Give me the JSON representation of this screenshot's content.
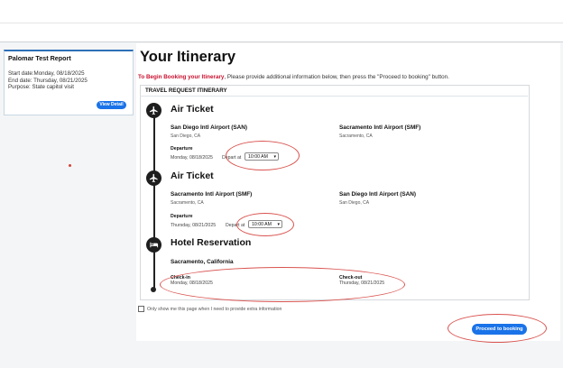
{
  "trip": {
    "name": "Palomar Test Report",
    "start_date": "Start date:Monday, 08/18/2025",
    "end_date": "End date:  Thursday, 08/21/2025",
    "purpose": "Purpose:  State capitol visit",
    "view_details_label": "View Detail"
  },
  "page": {
    "title": "Your Itinerary",
    "instruction_lead": "To Begin Booking your Itinerary",
    "instruction_rest": ", Please provide additional information below, then press the \"Proceed to booking\" button.",
    "section_title": "TRAVEL REQUEST ITINERARY"
  },
  "segments": [
    {
      "title": "Air Ticket",
      "from_airport": "San Diego Intl Airport (SAN)",
      "from_city": "San Diego, CA",
      "to_airport": "Sacramento Intl Airport (SMF)",
      "to_city": "Sacramento, CA",
      "departure_label": "Departure",
      "departure_date": "Monday, 08/18/2025",
      "depart_at_label": "Depart at",
      "depart_time": "10:00 AM"
    },
    {
      "title": "Air Ticket",
      "from_airport": "Sacramento Intl Airport (SMF)",
      "from_city": "Sacramento, CA",
      "to_airport": "San Diego Intl Airport (SAN)",
      "to_city": "San Diego, CA",
      "departure_label": "Departure",
      "departure_date": "Thursday, 08/21/2025",
      "depart_at_label": "Depart at",
      "depart_time": "10:00 AM"
    }
  ],
  "hotel": {
    "title": "Hotel Reservation",
    "location": "Sacramento, California",
    "checkin_label": "Check-in",
    "checkin_date": "Monday, 08/18/2025",
    "checkout_label": "Check-out",
    "checkout_date": "Thursday, 08/21/2025"
  },
  "footer": {
    "checkbox_label": "Only show me this page when I need to provide extra information",
    "proceed_label": "Proceed to booking"
  },
  "icons": {
    "flight": "airplane-icon",
    "hotel": "bed-icon"
  },
  "colors": {
    "accent_blue": "#1a73e8",
    "instruction_red": "#c8102e",
    "annotation_red": "#d9534f"
  }
}
